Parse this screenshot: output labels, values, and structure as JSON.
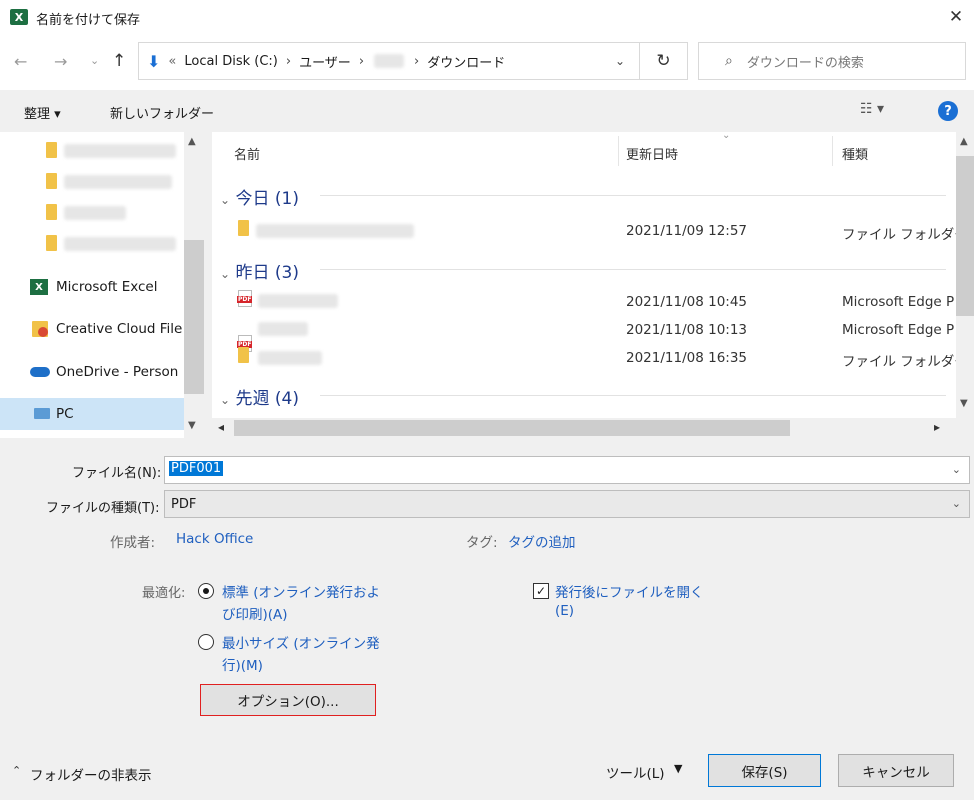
{
  "window": {
    "title": "名前を付けて保存",
    "app_icon": "X"
  },
  "nav": {
    "breadcrumb_prefix": "«",
    "breadcrumb": [
      "Local Disk (C:)",
      "ユーザー",
      "",
      "ダウンロード"
    ],
    "search_placeholder": "ダウンロードの検索"
  },
  "toolbar": {
    "organize": "整理 ▾",
    "new_folder": "新しいフォルダー",
    "help": "?"
  },
  "sidebar": {
    "items": [
      {
        "label": "Microsoft Excel",
        "icon": "excel-icon"
      },
      {
        "label": "Creative Cloud File",
        "icon": "creative-cloud-icon"
      },
      {
        "label": "OneDrive - Person",
        "icon": "onedrive-icon"
      },
      {
        "label": "PC",
        "icon": "pc-icon"
      }
    ]
  },
  "columns": {
    "name": "名前",
    "date": "更新日時",
    "type": "種類"
  },
  "groups": [
    {
      "header": "今日 (1)",
      "rows": [
        {
          "icon": "folder-icon",
          "date": "2021/11/09 12:57",
          "type": "ファイル フォルダー"
        }
      ]
    },
    {
      "header": "昨日 (3)",
      "rows": [
        {
          "icon": "pdf-icon",
          "date": "2021/11/08 10:45",
          "type": "Microsoft Edge P"
        },
        {
          "icon": "pdf-icon",
          "date": "2021/11/08 10:13",
          "type": "Microsoft Edge P"
        },
        {
          "icon": "folder-icon",
          "date": "2021/11/08 16:35",
          "type": "ファイル フォルダー"
        }
      ]
    },
    {
      "header": "先週 (4)",
      "rows": []
    }
  ],
  "form": {
    "filename_label": "ファイル名(N):",
    "filename_value": "PDF001",
    "filetype_label": "ファイルの種類(T):",
    "filetype_value": "PDF",
    "author_label": "作成者:",
    "author_value": "Hack Office",
    "tags_label": "タグ:",
    "tags_value": "タグの追加",
    "optimize_label": "最適化:",
    "opt_standard_line1": "標準 (オンライン発行およ",
    "opt_standard_line2": "び印刷)(A)",
    "opt_min_line1": "最小サイズ (オンライン発",
    "opt_min_line2": "行)(M)",
    "open_after_line1": "発行後にファイルを開く",
    "open_after_line2": "(E)",
    "options_button": "オプション(O)...",
    "optimize_selected": "standard",
    "open_after_checked": true
  },
  "footer": {
    "hide_folders": "フォルダーの非表示",
    "tools": "ツール(L)",
    "save": "保存(S)",
    "cancel": "キャンセル"
  },
  "colors": {
    "accent": "#1f5fbf",
    "excel": "#1d6f42",
    "highlight": "#e02020"
  }
}
